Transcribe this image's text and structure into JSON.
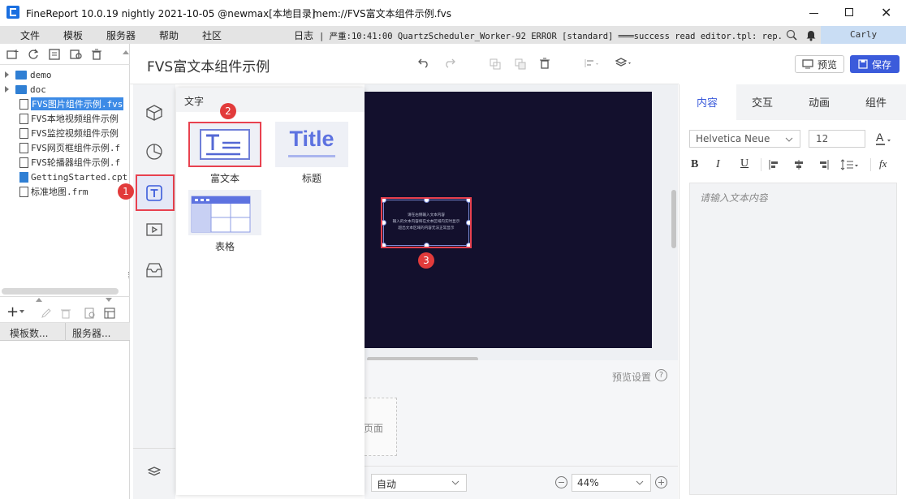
{
  "window": {
    "title": "FineReport 10.0.19 nightly 2021-10-05 @newmax[本地目录]",
    "file": "mem://FVS富文本组件示例.fvs"
  },
  "menu": [
    "文件",
    "模板",
    "服务器",
    "帮助",
    "社区"
  ],
  "log": {
    "label": "日志",
    "text": "| 严重:10:41:00 QuartzScheduler_Worker-92 ERROR [standard] ═══success read editor.tpl: rep..."
  },
  "user": "Carly",
  "tree": {
    "folders": [
      "demo",
      "doc"
    ],
    "files": [
      "FVS图片组件示例.fvs",
      "FVS本地视频组件示例",
      "FVS监控视频组件示例",
      "FVS网页框组件示例.f",
      "FVS轮播器组件示例.f",
      "GettingStarted.cpt",
      "标准地图.frm"
    ]
  },
  "bottom_tabs": [
    "模板数...",
    "服务器..."
  ],
  "doc_title": "FVS富文本组件示例",
  "toolbar": {
    "preview": "预览",
    "save": "保存"
  },
  "popup": {
    "header": "文字",
    "items": [
      {
        "label": "富文本",
        "thumb": "T≡"
      },
      {
        "label": "标题",
        "thumb": "Title"
      },
      {
        "label": "表格",
        "thumb": ""
      }
    ]
  },
  "canvas": {
    "text_lines": [
      "请在右侧输入文本内容",
      "输入的文本内容将在文本区域内实时显示",
      "超出文本区域的内容无法正常显示"
    ]
  },
  "badges": [
    "1",
    "2",
    "3"
  ],
  "lower": {
    "preview_settings": "预览设置",
    "page_label": "页面",
    "auto_select": "自动",
    "zoom": "44%"
  },
  "right": {
    "tabs": [
      "内容",
      "交互",
      "动画",
      "组件"
    ],
    "font": "Helvetica Neue",
    "size": "12",
    "textarea_placeholder": "请输入文本内容"
  },
  "colors": {
    "accent": "#3b5bdb",
    "annotation": "#e8414f",
    "canvas_bg": "#13102d"
  }
}
